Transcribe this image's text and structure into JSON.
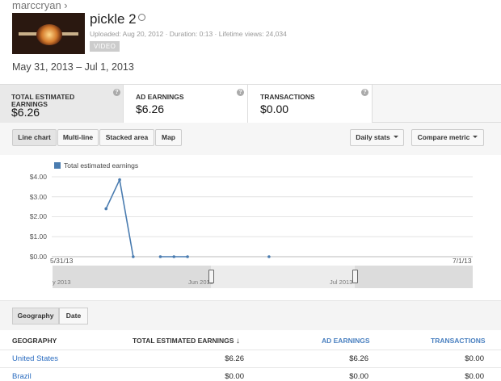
{
  "header": {
    "breadcrumb": "marccryan ›",
    "video_title": "pickle 2",
    "video_meta": "Uploaded: Aug 20, 2012  ·  Duration: 0:13  ·  Lifetime views: 24,034",
    "video_badge": "VIDEO",
    "date_range": "May 31, 2013 – Jul 1, 2013"
  },
  "metrics": [
    {
      "label": "TOTAL ESTIMATED EARNINGS",
      "value": "$6.26"
    },
    {
      "label": "AD EARNINGS",
      "value": "$6.26"
    },
    {
      "label": "TRANSACTIONS",
      "value": "$0.00"
    }
  ],
  "help_glyph": "?",
  "toolbar": {
    "chart_types": [
      "Line chart",
      "Multi-line",
      "Stacked area",
      "Map"
    ],
    "active_chart_type": "Line chart",
    "daily_stats": "Daily stats",
    "compare_metric": "Compare metric"
  },
  "chart_data": {
    "type": "line",
    "legend": "Total estimated earnings",
    "ylim": [
      0,
      4
    ],
    "yticks": [
      "$4.00",
      "$3.00",
      "$2.00",
      "$1.00",
      "$0.00"
    ],
    "x_start_label": "5/31/13",
    "x_end_label": "7/1/13",
    "series": [
      {
        "name": "Total estimated earnings",
        "segments": [
          [
            {
              "day": 4,
              "value": 2.4
            },
            {
              "day": 5,
              "value": 3.85
            },
            {
              "day": 6,
              "value": 0.0
            }
          ],
          [
            {
              "day": 8,
              "value": 0.0
            },
            {
              "day": 9,
              "value": 0.0
            },
            {
              "day": 10,
              "value": 0.0
            }
          ],
          [
            {
              "day": 16,
              "value": 0.0
            }
          ]
        ]
      }
    ],
    "color": "#4a7cb0",
    "grid": true
  },
  "navigator": {
    "labels": [
      "y 2013",
      "Jun 2013",
      "Jul 2013"
    ]
  },
  "geography": {
    "tabs": [
      "Geography",
      "Date"
    ],
    "active_tab": "Geography"
  },
  "table": {
    "columns": [
      "GEOGRAPHY",
      "TOTAL ESTIMATED EARNINGS",
      "AD EARNINGS",
      "TRANSACTIONS"
    ],
    "sort_arrow": "↓",
    "rows": [
      [
        "United States",
        "$6.26",
        "$6.26",
        "$0.00"
      ],
      [
        "Brazil",
        "$0.00",
        "$0.00",
        "$0.00"
      ]
    ]
  }
}
